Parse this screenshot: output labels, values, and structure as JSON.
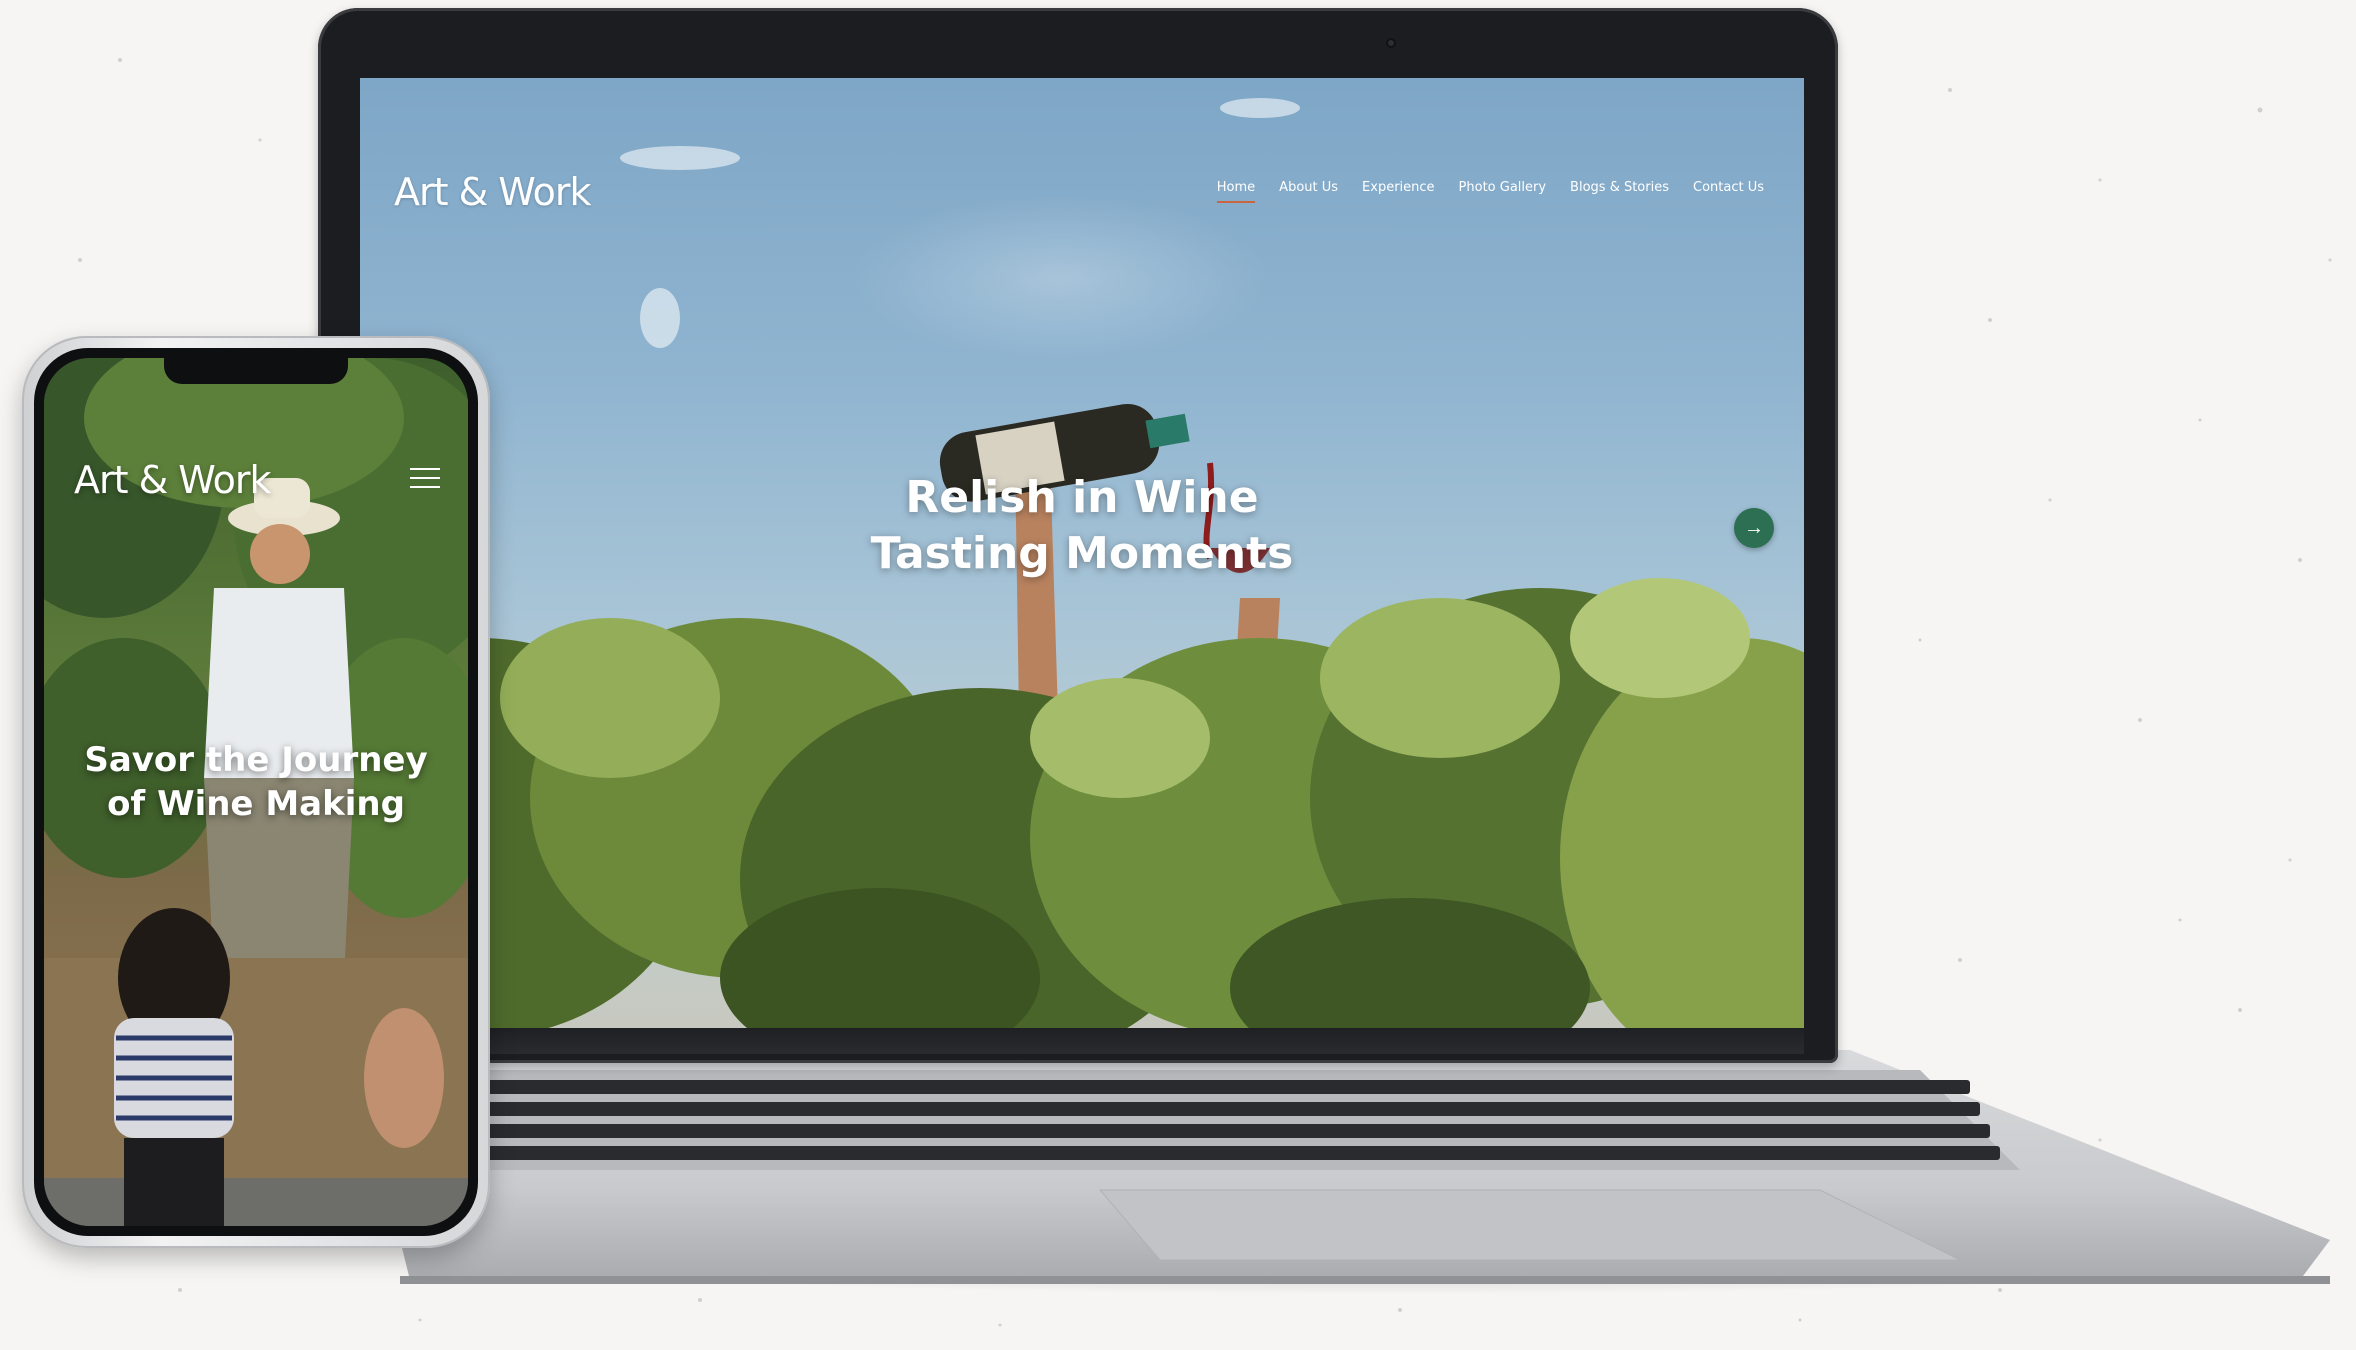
{
  "desktop_site": {
    "logo": "Art & Work",
    "nav": [
      "Home",
      "About Us",
      "Experience",
      "Photo Gallery",
      "Blogs & Stories",
      "Contact Us"
    ],
    "active_nav": "Home",
    "hero_title_line1": "Relish in Wine",
    "hero_title_line2": "Tasting Moments",
    "next_icon": "arrow-right-icon"
  },
  "mobile_site": {
    "logo": "Art & Work",
    "menu_icon": "hamburger-icon",
    "hero_title_line1": "Savor the Journey",
    "hero_title_line2": "of Wine Making"
  },
  "colors": {
    "accent_underline": "#c9663f",
    "next_button": "#2d6f52",
    "text": "#ffffff"
  }
}
